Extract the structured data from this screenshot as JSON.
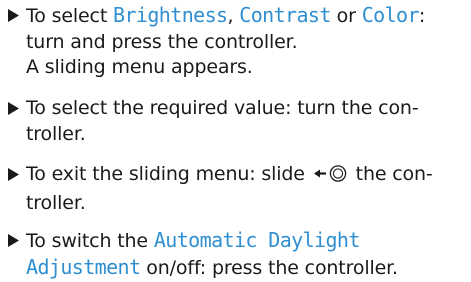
{
  "steps": [
    {
      "line1_pre": "To select ",
      "term1": "Brightness",
      "sep1": ", ",
      "term2": "Contrast",
      "sep2": " or ",
      "term3": "Color",
      "sep3": ":",
      "line2": "turn and press the controller.",
      "line3": "A sliding menu appears."
    },
    {
      "line1": "To select the required value: turn the con-",
      "line2": "troller."
    },
    {
      "line1_pre": "To exit the sliding menu: slide ",
      "slide_icon": "slide-left-controller-icon",
      "line1_post": " the con-",
      "line2": "troller."
    },
    {
      "line1_pre": "To switch the ",
      "term1": "Automatic Daylight",
      "term2": "Adjustment",
      "line2_post": " on/off: press the controller."
    }
  ],
  "icons": {
    "bullet": "triangle-right-bullet-icon",
    "slide": "slide-left-controller-icon"
  },
  "colors": {
    "text": "#1a1a1a",
    "ui_term": "#2f8fd0"
  }
}
